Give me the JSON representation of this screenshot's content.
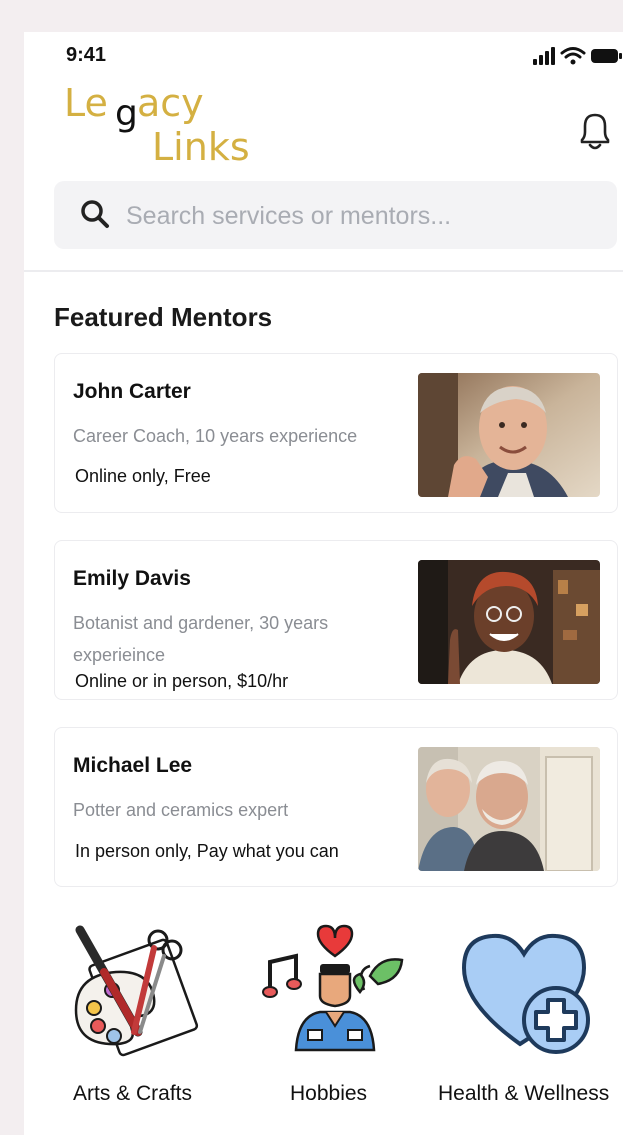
{
  "status": {
    "time": "9:41"
  },
  "header": {
    "logo_line1_start": "Le",
    "logo_glyph": "g",
    "logo_line1_end": "acy",
    "logo_line2": "Links",
    "brand_color": "#d4b042"
  },
  "search": {
    "placeholder": "Search services or mentors..."
  },
  "featured": {
    "title": "Featured Mentors",
    "mentors": [
      {
        "name": "John Carter",
        "description": "Career Coach, 10 years experience",
        "pricing": "Online only, Free"
      },
      {
        "name": "Emily Davis",
        "description": "Botanist and gardener, 30 years experieince",
        "pricing": "Online or in person, $10/hr"
      },
      {
        "name": "Michael Lee",
        "description": "Potter and ceramics expert",
        "pricing": "In person only, Pay what you can"
      }
    ]
  },
  "categories": [
    {
      "label": "Arts & Crafts",
      "icon": "palette-icon"
    },
    {
      "label": "Hobbies",
      "icon": "hobbies-icon"
    },
    {
      "label": "Health & Wellness",
      "icon": "health-heart-icon"
    }
  ]
}
